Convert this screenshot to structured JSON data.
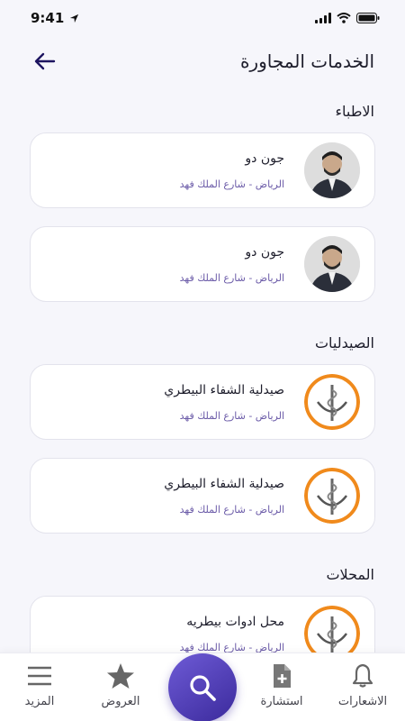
{
  "status": {
    "time": "9:41"
  },
  "header": {
    "title": "الخدمات المجاورة"
  },
  "sections": [
    {
      "title": "الاطباء",
      "items": [
        {
          "name": "جون دو",
          "address": "الرياض - شارع الملك فهد",
          "icon": "doctor-photo"
        },
        {
          "name": "جون دو",
          "address": "الرياض - شارع الملك فهد",
          "icon": "doctor-photo"
        }
      ]
    },
    {
      "title": "الصيدليات",
      "items": [
        {
          "name": "صيدلية الشفاء البيطري",
          "address": "الرياض - شارع الملك فهد",
          "icon": "pharmacy-logo"
        },
        {
          "name": "صيدلية الشفاء البيطري",
          "address": "الرياض - شارع الملك فهد",
          "icon": "pharmacy-logo"
        }
      ]
    },
    {
      "title": "المحلات",
      "items": [
        {
          "name": "محل ادوات بيطريه",
          "address": "الرياض - شارع الملك فهد",
          "icon": "pharmacy-logo"
        }
      ]
    }
  ],
  "nav": {
    "notifications": "الاشعارات",
    "consultation": "استشارة",
    "offers": "العروض",
    "more": "المزيد"
  },
  "colors": {
    "accent": "#4a3bb5",
    "address": "#6b5ba8",
    "logo_orange": "#f08a1c"
  }
}
